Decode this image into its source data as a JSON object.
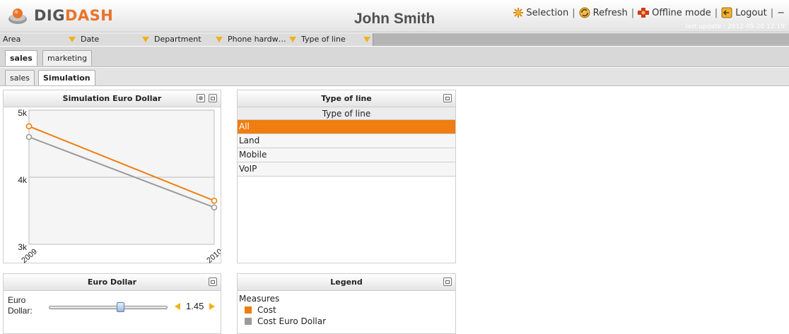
{
  "header": {
    "logo_part1": "DIG",
    "logo_part2": "DASH",
    "user_name": "John Smith",
    "toolbar": {
      "selection": "Selection",
      "refresh": "Refresh",
      "offline": "Offline mode",
      "logout": "Logout",
      "minimize": "−"
    },
    "last_update": "last update : 2012-09-20 12:19"
  },
  "filters": [
    "Area",
    "Date",
    "Department",
    "Phone hardw…",
    "Type of line"
  ],
  "tabs_primary": [
    {
      "label": "sales",
      "active": true
    },
    {
      "label": "marketing",
      "active": false
    }
  ],
  "tabs_secondary": [
    {
      "label": "sales",
      "active": false
    },
    {
      "label": "Simulation",
      "active": true
    }
  ],
  "panels": {
    "simulation": {
      "title": "Simulation Euro Dollar"
    },
    "type_of_line": {
      "title": "Type of line",
      "column_header": "Type of line",
      "rows": [
        "All",
        "Land",
        "Mobile",
        "VoIP"
      ],
      "selected": "All"
    },
    "euro_dollar": {
      "title": "Euro Dollar",
      "label": "Euro Dollar:",
      "value": "1.45",
      "slider_fraction": 0.57
    },
    "legend": {
      "title": "Legend",
      "heading": "Measures",
      "items": [
        {
          "label": "Cost",
          "color": "#ef7d0f"
        },
        {
          "label": "Cost Euro Dollar",
          "color": "#9a9a9a"
        }
      ]
    }
  },
  "chart_data": {
    "type": "line",
    "title": "Simulation Euro Dollar",
    "x": [
      "2009",
      "2010"
    ],
    "ylim": [
      3000,
      5000
    ],
    "yticks": [
      "3k",
      "4k",
      "5k"
    ],
    "grid": true,
    "series": [
      {
        "name": "Cost",
        "color": "#ef7d0f",
        "values": [
          4760,
          3650
        ]
      },
      {
        "name": "Cost Euro Dollar",
        "color": "#9a9a9a",
        "values": [
          4600,
          3550
        ]
      }
    ]
  }
}
